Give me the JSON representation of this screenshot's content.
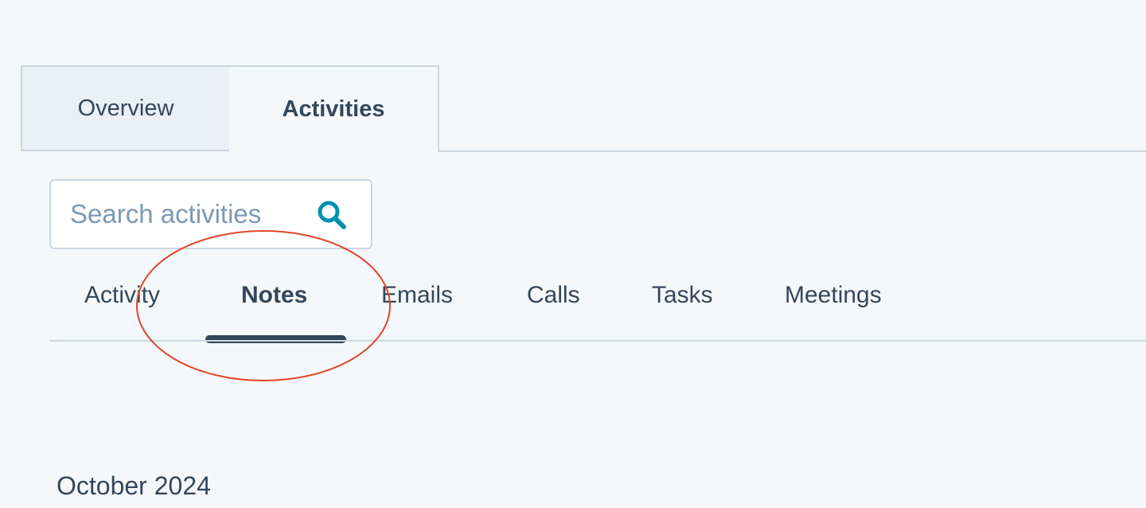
{
  "top_tabs": {
    "overview": "Overview",
    "activities": "Activities"
  },
  "search": {
    "placeholder": "Search activities",
    "icon": "search-icon"
  },
  "sub_tabs": {
    "activity": "Activity",
    "notes": "Notes",
    "emails": "Emails",
    "calls": "Calls",
    "tasks": "Tasks",
    "meetings": "Meetings",
    "selected": "Notes"
  },
  "timeline": {
    "month": "October 2024"
  },
  "colors": {
    "background": "#f5f8fa",
    "text": "#33475b",
    "border": "#cbd6e2",
    "inactive_tab": "#eaf0f6",
    "search_icon": "#0091ae",
    "annotation": "#e0452a"
  }
}
